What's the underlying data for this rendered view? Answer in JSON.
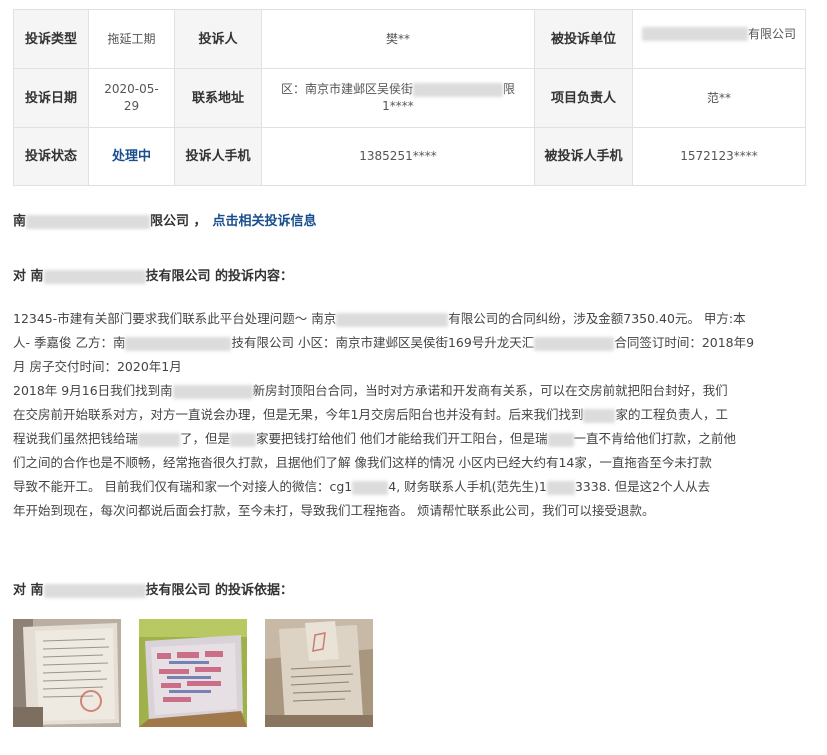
{
  "table": {
    "row1": {
      "type_label": "投诉类型",
      "type_value": "拖延工期",
      "complainant_label": "投诉人",
      "complainant_value": "樊**",
      "company_label": "被投诉单位",
      "company_value_suffix": "有限公司"
    },
    "row2": {
      "date_label": "投诉日期",
      "date_value": "2020-05-29",
      "address_label": "联系地址",
      "address_prefix": "区：南京市建邺区吴侯街",
      "address_tail": "限",
      "address_line2": "1****",
      "manager_label": "项目负责人",
      "manager_value": "范**"
    },
    "row3": {
      "status_label": "投诉状态",
      "status_value": "处理中",
      "phone_label": "投诉人手机",
      "phone_value": "1385251****",
      "company_phone_label": "被投诉人手机",
      "company_phone_value": "1572123****"
    }
  },
  "company_line": {
    "prefix": "南",
    "suffix": "限公司 ，",
    "link": "点击相关投诉信息"
  },
  "content_heading": {
    "prefix": "对 南",
    "suffix": "技有限公司 的投诉内容："
  },
  "content": {
    "l1a": "12345-市建有关部门要求我们联系此平台处理问题～ 南京",
    "l1b": "有限公司的合同纠纷，涉及金额7350.40元。 甲方:本",
    "l2a": "人- 季嘉俊 乙方：南",
    "l2b": "技有限公司 小区：南京市建邺区吴侯街169号升龙天汇",
    "l2c": "合同签订时间：2018年9",
    "l3": "月 房子交付时间：2020年1月",
    "l4a": "2018年 9月16日我们找到南",
    "l4b": "新房封顶阳台合同，当时对方承诺和开发商有关系，可以在交房前就把阳台封好，我们",
    "l5a": "在交房前开始联系对方，对方一直说会办理，但是无果，今年1月交房后阳台也并没有封。后来我们找到",
    "l5b": "家的工程负责人，工",
    "l6a": "程说我们虽然把钱给瑞",
    "l6b": "了，但是",
    "l6c": "家要把钱打给他们 他们才能给我们开工阳台，但是瑞",
    "l6d": "一直不肯给他们打款，之前他",
    "l7": "们之间的合作也是不顺畅，经常拖沓很久打款，且据他们了解 像我们这样的情况 小区内已经大约有14家，一直拖沓至今未打款",
    "l8": "导致不能开工。 目前我们仅有瑞和家一个对接人的微信：cg1",
    "l8b": "4, 财务联系人手机(范先生)1",
    "l8c": "3338. 但是这2个人从去",
    "l9": "年开始到现在，每次问都说后面会打款，至今未打，导致我们工程拖沓。 烦请帮忙联系此公司，我们可以接受退款。"
  },
  "basis_heading": {
    "prefix": "对 南",
    "suffix": "技有限公司 的投诉依据："
  },
  "colors": {
    "link": "#1a4e8c",
    "label_bg": "#f5f5f5",
    "border": "#e1e1e1"
  }
}
